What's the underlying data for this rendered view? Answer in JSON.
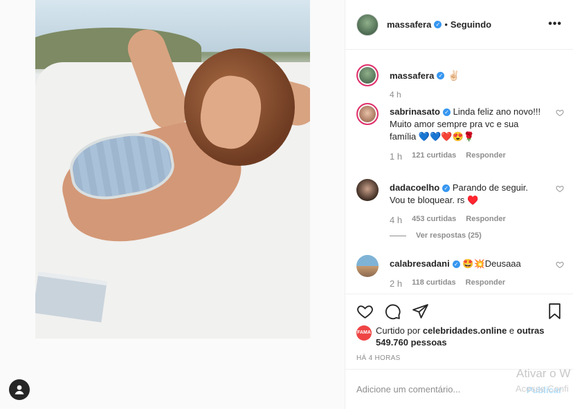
{
  "post": {
    "author": "massafera",
    "follow_dot": "•",
    "follow_status": "Seguindo",
    "more": "•••",
    "caption_emoji": "✌🏻",
    "caption_time": "4 h",
    "liked_by_badge": "FAMA",
    "liked_prefix": "Curtido por ",
    "liked_by": "celebridades.online",
    "liked_and": " e ",
    "liked_others": "outras 549.760 pessoas",
    "timestamp": "HÁ 4 HORAS"
  },
  "comments": [
    {
      "username": "sabrinasato",
      "text": "Linda feliz ano novo!!! Muito amor sempre pra vc e sua família 💙💙❤️😍🌹",
      "time": "1 h",
      "likes": "121 curtidas",
      "reply": "Responder",
      "avatar_color": "#c79a83"
    },
    {
      "username": "dadacoelho",
      "text": "Parando de seguir. Vou te bloquear. rs ♥️",
      "time": "4 h",
      "likes": "453 curtidas",
      "reply": "Responder",
      "replies": "Ver respostas (25)",
      "avatar_color": "#5a4638"
    },
    {
      "username": "calabresadani",
      "text": "🤩💥Deusaaa",
      "time": "2 h",
      "likes": "118 curtidas",
      "reply": "Responder",
      "avatar_color": "#6ea5c7"
    }
  ],
  "add_comment": {
    "placeholder": "Adicione um comentário...",
    "post_label": "Publicar"
  },
  "os_watermark": {
    "line1": "Ativar o W",
    "line2": "Acesse Confi"
  },
  "colors": {
    "verified": "#3897f0",
    "link_blue": "#b2dffc",
    "secondary_text": "#8e8e8e",
    "primary_text": "#262626"
  }
}
